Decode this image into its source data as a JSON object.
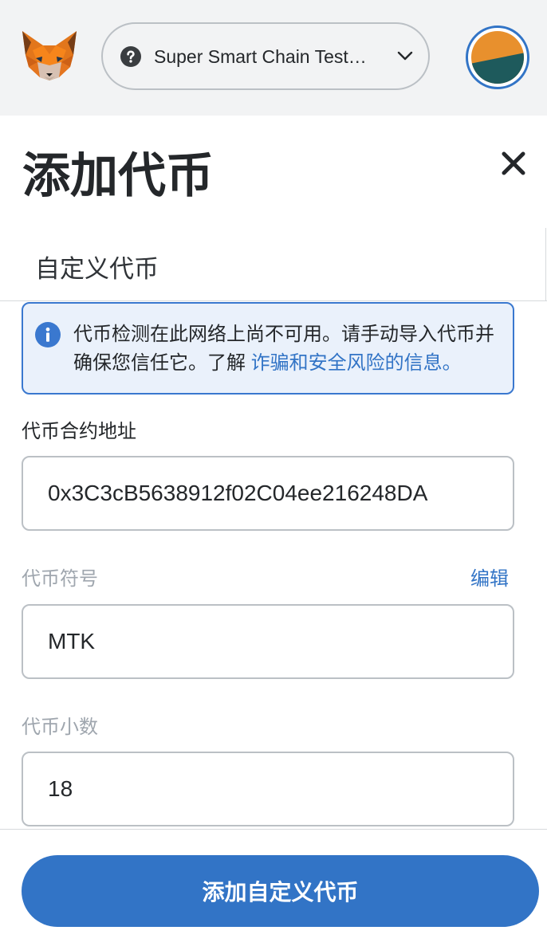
{
  "theme": {
    "accent": "#3274c6",
    "text": "#24272a",
    "muted": "#9fa6ae",
    "border": "#bbc0c5",
    "header_bg": "#f2f3f4",
    "notice_bg": "#eaf1fb",
    "notice_border": "#3a78cf"
  },
  "header": {
    "logo_icon": "metamask-fox-icon",
    "network": {
      "label": "Super Smart Chain Test…",
      "status_icon": "question-circle-icon",
      "dropdown_icon": "chevron-down-icon"
    },
    "account_avatar": {
      "icon": "account-avatar-icon",
      "colors": [
        "#e8902d",
        "#1e5a5c"
      ]
    }
  },
  "page": {
    "title": "添加代币",
    "close_icon": "close-icon"
  },
  "tabs": [
    {
      "label": "自定义代币"
    }
  ],
  "notice": {
    "icon": "info-icon",
    "text": "代币检测在此网络上尚不可用。请手动导入代币并确保您信任它。了解 ",
    "link": "诈骗和安全风险的信息。"
  },
  "form": {
    "contract_address": {
      "label": "代币合约地址",
      "value": "0x3C3cB5638912f02C04ee216248DA"
    },
    "symbol": {
      "label": "代币符号",
      "value": "MTK",
      "edit_label": "编辑"
    },
    "decimals": {
      "label": "代币小数",
      "value": "18"
    }
  },
  "footer": {
    "submit_label": "添加自定义代币"
  }
}
